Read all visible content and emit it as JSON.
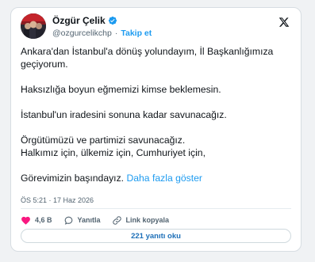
{
  "author": {
    "display_name": "Özgür Çelik",
    "handle": "@ozgurcelikchp",
    "separator": "·",
    "follow_label": "Takip et",
    "verified": true
  },
  "tweet": {
    "line1": "Ankara'dan İstanbul'a dönüş yolundayım, İl Başkanlığımıza geçiyorum.",
    "line2": "Haksızlığa boyun eğmemizi kimse beklemesin.",
    "line3": "İstanbul'un iradesini sonuna kadar savunacağız.",
    "line4a": "Örgütümüzü ve partimizi savunacağız.",
    "line4b": "Halkımız için, ülkemiz için, Cumhuriyet için,",
    "line5": "Görevimizin başındayız.",
    "show_more": "Daha fazla göster"
  },
  "timestamp": "ÖS 5:21 · 17 Haz 2026",
  "actions": {
    "likes": "4,6 B",
    "reply_label": "Yanıtla",
    "copy_link_label": "Link kopyala"
  },
  "read_replies": "221 yanıtı oku",
  "colors": {
    "accent": "#1d9bf0",
    "like": "#f91880",
    "text": "#0f1419",
    "muted": "#536471"
  },
  "icons": [
    "verified-badge-icon",
    "x-logo-icon",
    "heart-icon",
    "reply-icon",
    "link-icon"
  ]
}
